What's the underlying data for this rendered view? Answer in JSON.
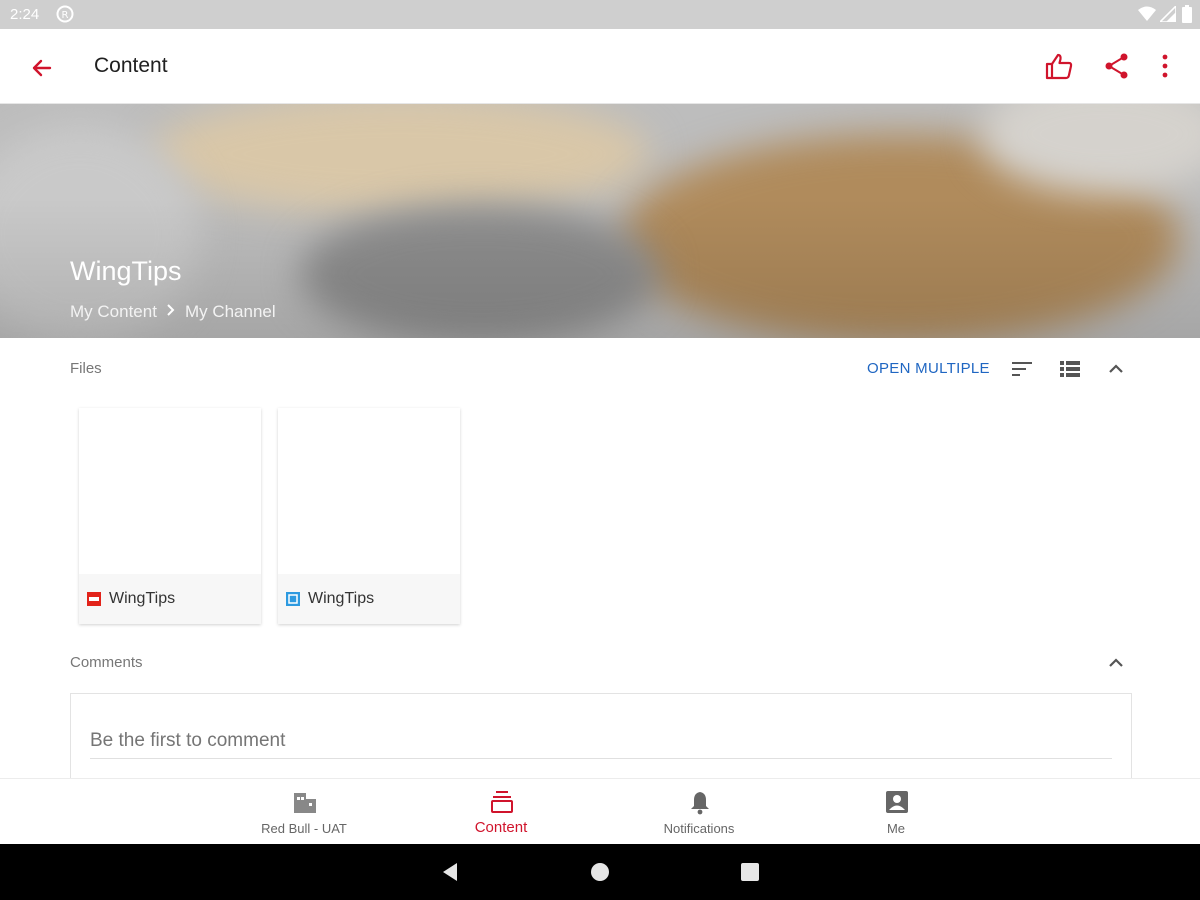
{
  "status_bar": {
    "time": "2:24",
    "icons": [
      "notification-icon",
      "wifi-icon",
      "signal-icon",
      "battery-icon"
    ]
  },
  "app_bar": {
    "title": "Content",
    "actions": [
      "like-icon",
      "share-icon",
      "more-icon"
    ],
    "accent_color": "#d0142c"
  },
  "hero": {
    "title": "WingTips",
    "breadcrumb": [
      "My Content",
      "My Channel"
    ]
  },
  "files": {
    "label": "Files",
    "open_multiple_label": "OPEN MULTIPLE",
    "tools": [
      "sort-icon",
      "list-view-icon",
      "collapse-icon"
    ],
    "items": [
      {
        "name": "WingTips",
        "type_icon": "pdf-file-icon",
        "icon_color": "#e2231a"
      },
      {
        "name": "WingTips",
        "type_icon": "doc-file-icon",
        "icon_color": "#2d9ae0"
      }
    ]
  },
  "comments": {
    "label": "Comments",
    "placeholder": "Be the first to comment"
  },
  "bottom_nav": {
    "items": [
      {
        "label": "Red Bull - UAT",
        "icon": "buildings-icon",
        "active": false
      },
      {
        "label": "Content",
        "icon": "content-stack-icon",
        "active": true
      },
      {
        "label": "Notifications",
        "icon": "bell-icon",
        "active": false
      },
      {
        "label": "Me",
        "icon": "profile-icon",
        "active": false
      }
    ]
  }
}
